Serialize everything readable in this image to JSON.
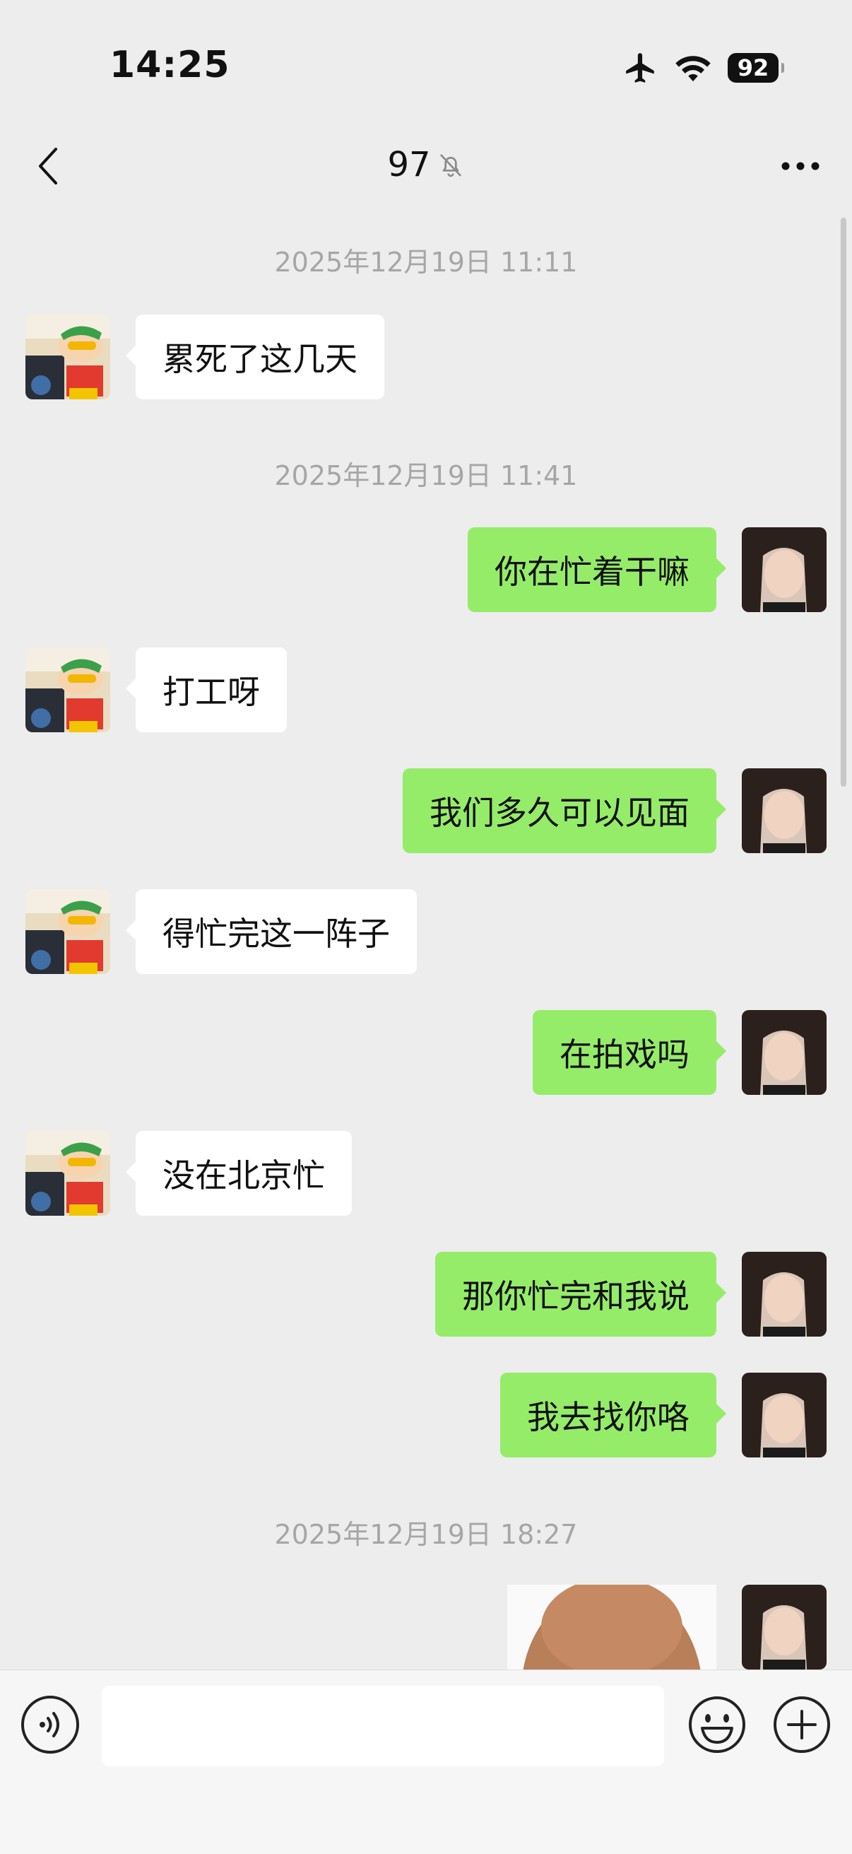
{
  "status_bar": {
    "time": "14:25",
    "battery": "92"
  },
  "header": {
    "title": "97"
  },
  "messages": [
    {
      "type": "timestamp",
      "text": "2025年12月19日 11:11"
    },
    {
      "type": "left",
      "text": "累死了这几天"
    },
    {
      "type": "timestamp",
      "text": "2025年12月19日 11:41"
    },
    {
      "type": "right",
      "text": "你在忙着干嘛"
    },
    {
      "type": "left",
      "text": "打工呀"
    },
    {
      "type": "right",
      "text": "我们多久可以见面"
    },
    {
      "type": "left",
      "text": "得忙完这一阵子"
    },
    {
      "type": "right",
      "text": "在拍戏吗"
    },
    {
      "type": "left",
      "text": "没在北京忙"
    },
    {
      "type": "right",
      "text": "那你忙完和我说"
    },
    {
      "type": "right",
      "text": "我去找你咯"
    },
    {
      "type": "timestamp",
      "text": "2025年12月19日 18:27"
    },
    {
      "type": "right-image"
    }
  ],
  "input": {
    "placeholder": "",
    "value": ""
  },
  "colors": {
    "background": "#ededed",
    "outgoing_bubble": "#95ec69",
    "incoming_bubble": "#ffffff",
    "timestamp": "#a6a6a6"
  }
}
